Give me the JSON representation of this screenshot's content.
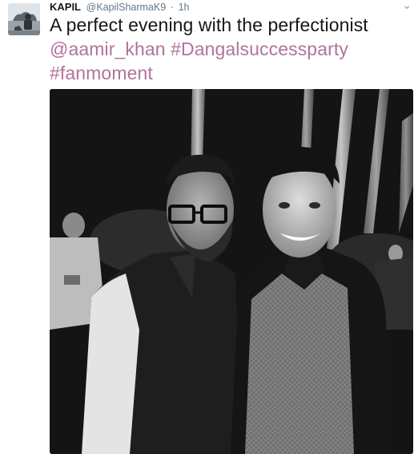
{
  "tweet": {
    "display_name": "KAPIL",
    "handle": "@KapilSharmaK9",
    "separator": "·",
    "time": "1h",
    "text_line1": "A perfect evening with the perfectionist",
    "mention": "@aamir_khan",
    "hashtag1": "#Dangalsuccessparty",
    "hashtag2": "#fanmoment"
  },
  "icons": {
    "more": "chevron-down-icon",
    "avatar": "avatar"
  },
  "colors": {
    "link": "#b1739a",
    "meta": "#657786",
    "text": "#14171a"
  },
  "media": {
    "type": "photo",
    "style": "black-and-white"
  }
}
